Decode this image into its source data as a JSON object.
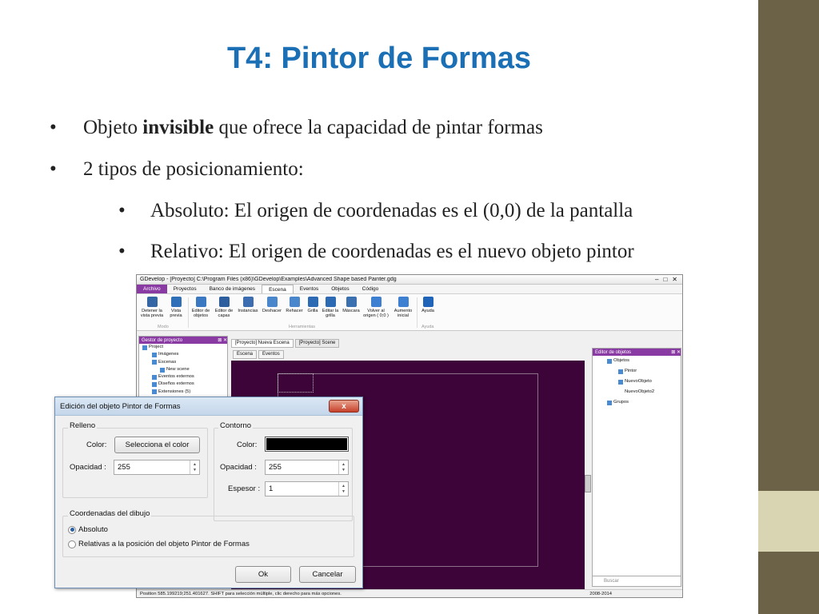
{
  "slide": {
    "title": "T4: Pintor de Formas",
    "bullet1_pre": "Objeto ",
    "bullet1_bold": "invisible",
    "bullet1_post": " que ofrece la capacidad de pintar formas",
    "bullet2": "2 tipos de posicionamiento:",
    "bullet3": "Absoluto: El origen de coordenadas es el (0,0) de la pantalla",
    "bullet4": "Relativo: El origen de coordenadas es el nuevo objeto pintor",
    "bullet_glyph": "•",
    "title_color": "#1a6fb5"
  },
  "app": {
    "window_title": "GDevelop - [Proyecto] C:\\Program Files (x86)\\GDevelop\\Examples\\Advanced Shape based Painter.gdg",
    "menu": [
      "Archivo",
      "Proyectos",
      "Banco de imágenes",
      "Escena",
      "Eventos",
      "Objetos",
      "Código"
    ],
    "ribbon": {
      "buttons": [
        {
          "label": "Detener la vista previa",
          "color": "#3465a4"
        },
        {
          "label": "Vista previa",
          "color": "#2f6fb8"
        },
        {
          "label": "Editor de objetos",
          "color": "#3b78c2"
        },
        {
          "label": "Editor de capas",
          "color": "#2d5f9e"
        },
        {
          "label": "Instancias",
          "color": "#3c6db0"
        },
        {
          "label": "Deshacer",
          "color": "#4a86cc"
        },
        {
          "label": "Rehacer",
          "color": "#4a86cc"
        },
        {
          "label": "Grilla",
          "color": "#2d6ab4"
        },
        {
          "label": "Editar la grilla",
          "color": "#2d6ab4"
        },
        {
          "label": "Máscara",
          "color": "#3a6fb0"
        },
        {
          "label": "Volver al origen ( 0;0 )",
          "color": "#3d7fd0"
        },
        {
          "label": "Aumento inicial",
          "color": "#3d7fd0"
        },
        {
          "label": "Ayuda",
          "color": "#1f64b8"
        }
      ],
      "groups": [
        "Modo",
        "Herramientas",
        "Ayuda"
      ]
    },
    "left_panel": {
      "title": "Gestor de proyecto",
      "items": [
        "Project",
        "Imágenes",
        "Escenas",
        "New scene",
        "Eventos externos",
        "Diseños externos",
        "Extensiones (5)"
      ]
    },
    "tabs": [
      "[Proyecto] Nueva Escena",
      "[Proyecto] Scene"
    ],
    "subtabs": [
      "Escena",
      "Eventos"
    ],
    "right_panel": {
      "title": "Editor de objetos",
      "items": [
        "Objetos",
        "Pintor",
        "NuevoObjeto",
        "NuevoObjeto2",
        "Grupos"
      ]
    },
    "search_placeholder": "Buscar",
    "status_left": "Position 585.199219;251.401627. SHIFT para selección múltiple, clic derecho para más opciones.",
    "status_right": "2008-2014",
    "canvas_color": "#3d0439",
    "accent_color": "#8a3aa3"
  },
  "dialog": {
    "title": "Edición del objeto Pintor de Formas",
    "close_glyph": "x",
    "fill_group": "Relleno",
    "fill_color_label": "Color:",
    "fill_color_button": "Selecciona el color",
    "fill_opacity_label": "Opacidad :",
    "fill_opacity_value": "255",
    "outline_group": "Contorno",
    "outline_color_label": "Color:",
    "outline_color_value": "#000000",
    "outline_opacity_label": "Opacidad :",
    "outline_opacity_value": "255",
    "outline_thickness_label": "Espesor :",
    "outline_thickness_value": "1",
    "coords_group": "Coordenadas del dibujo",
    "radio_absolute": "Absoluto",
    "radio_relative": "Relativas a la posición del objeto Pintor de Formas",
    "selected": "absolute",
    "ok_label": "Ok",
    "cancel_label": "Cancelar"
  }
}
